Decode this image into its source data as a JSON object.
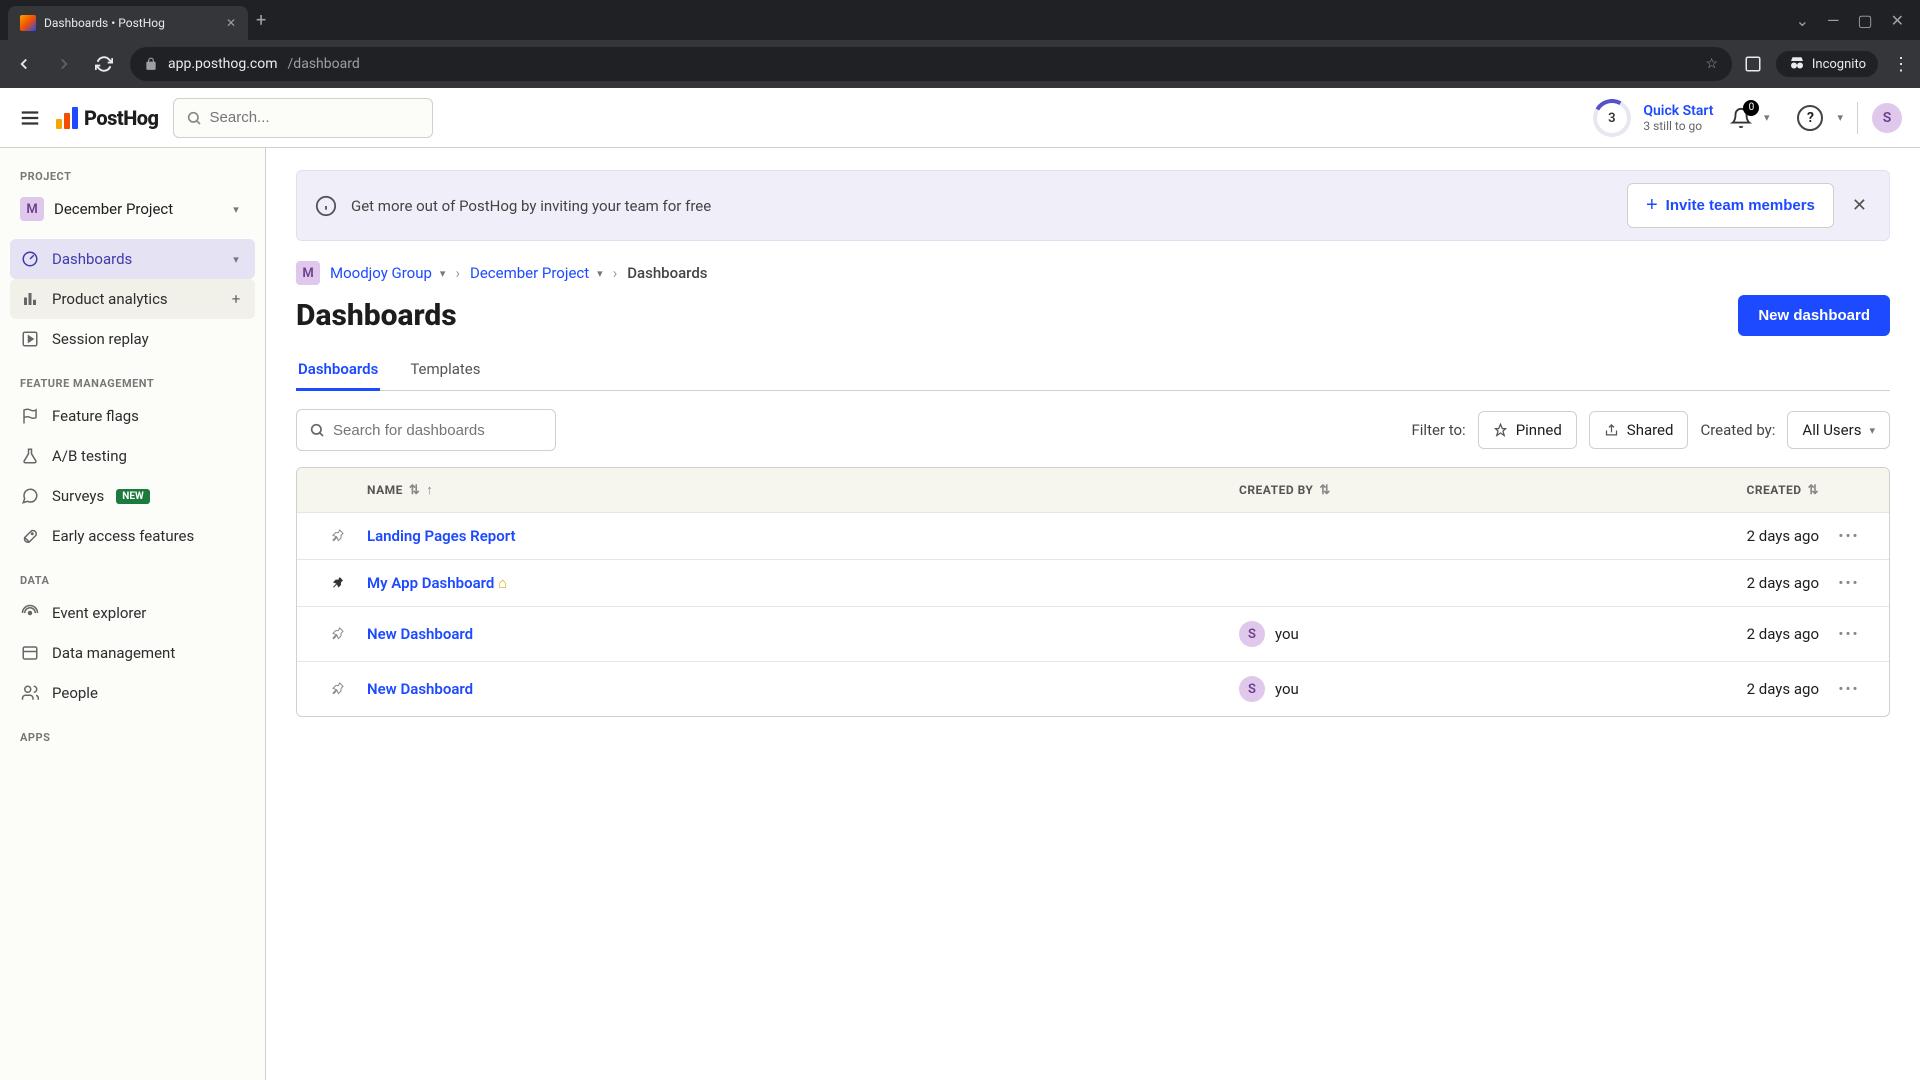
{
  "browser": {
    "tab_title": "Dashboards • PostHog",
    "url_host": "app.posthog.com",
    "url_path": "/dashboard",
    "incognito_label": "Incognito"
  },
  "header": {
    "logo_text": "PostHog",
    "search_placeholder": "Search...",
    "quickstart": {
      "badge": "3",
      "title": "Quick Start",
      "subtitle": "3 still to go"
    },
    "notif_count": "0",
    "avatar_initial": "S"
  },
  "sidebar": {
    "section_project": "PROJECT",
    "project_initial": "M",
    "project_name": "December Project",
    "items_main": [
      {
        "label": "Dashboards",
        "active": true,
        "icon": "gauge"
      },
      {
        "label": "Product analytics",
        "active": false,
        "icon": "bars",
        "trail": "plus",
        "hovered": true
      },
      {
        "label": "Session replay",
        "active": false,
        "icon": "play"
      }
    ],
    "section_feature": "FEATURE MANAGEMENT",
    "items_feature": [
      {
        "label": "Feature flags",
        "icon": "flag"
      },
      {
        "label": "A/B testing",
        "icon": "flask"
      },
      {
        "label": "Surveys",
        "icon": "chat",
        "badge": "NEW"
      },
      {
        "label": "Early access features",
        "icon": "rocket"
      }
    ],
    "section_data": "DATA",
    "items_data": [
      {
        "label": "Event explorer",
        "icon": "live"
      },
      {
        "label": "Data management",
        "icon": "database"
      },
      {
        "label": "People",
        "icon": "people"
      }
    ],
    "section_apps": "APPS"
  },
  "banner": {
    "text": "Get more out of PostHog by inviting your team for free",
    "button": "Invite team members"
  },
  "breadcrumbs": {
    "org_initial": "M",
    "org": "Moodjoy Group",
    "project": "December Project",
    "current": "Dashboards"
  },
  "page": {
    "title": "Dashboards",
    "new_button": "New dashboard",
    "tabs": [
      "Dashboards",
      "Templates"
    ],
    "active_tab": 0,
    "search_placeholder": "Search for dashboards",
    "filter_to": "Filter to:",
    "pinned": "Pinned",
    "shared": "Shared",
    "created_by_label": "Created by:",
    "all_users": "All Users"
  },
  "table": {
    "columns": {
      "name": "NAME",
      "created_by": "CREATED BY",
      "created": "CREATED"
    },
    "rows": [
      {
        "name": "Landing Pages Report",
        "pinned": false,
        "home": false,
        "creator": null,
        "created": "2 days ago"
      },
      {
        "name": "My App Dashboard",
        "pinned": true,
        "home": true,
        "creator": null,
        "created": "2 days ago"
      },
      {
        "name": "New Dashboard",
        "pinned": false,
        "home": false,
        "creator": {
          "initial": "S",
          "label": "you"
        },
        "created": "2 days ago"
      },
      {
        "name": "New Dashboard",
        "pinned": false,
        "home": false,
        "creator": {
          "initial": "S",
          "label": "you"
        },
        "created": "2 days ago"
      }
    ]
  }
}
